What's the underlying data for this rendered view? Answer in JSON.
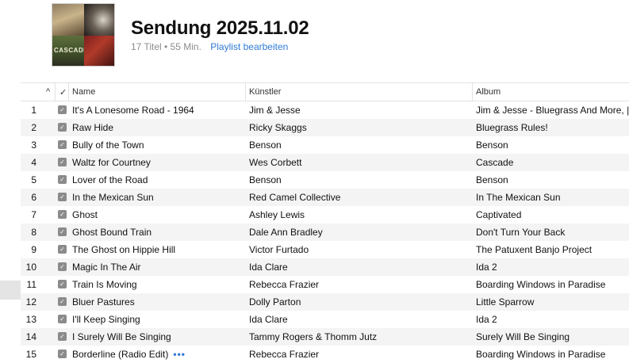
{
  "playlist": {
    "title": "Sendung 2025.11.02",
    "meta": "17 Titel • 55 Min.",
    "edit_label": "Playlist bearbeiten",
    "artwork_text": "CASCADE"
  },
  "columns": {
    "sort_indicator": "^",
    "check": "✓",
    "name": "Name",
    "artist": "Künstler",
    "album": "Album"
  },
  "tracks": [
    {
      "num": "1",
      "name": "It's A Lonesome Road - 1964",
      "artist": "Jim & Jesse",
      "album": "Jim & Jesse - Bluegrass And More, |"
    },
    {
      "num": "2",
      "name": "Raw Hide",
      "artist": "Ricky Skaggs",
      "album": "Bluegrass Rules!"
    },
    {
      "num": "3",
      "name": "Bully of the Town",
      "artist": "Benson",
      "album": "Benson"
    },
    {
      "num": "4",
      "name": "Waltz for Courtney",
      "artist": "Wes Corbett",
      "album": "Cascade"
    },
    {
      "num": "5",
      "name": "Lover of the Road",
      "artist": "Benson",
      "album": "Benson"
    },
    {
      "num": "6",
      "name": " In the Mexican Sun",
      "artist": "Red Camel Collective",
      "album": "In The Mexican Sun"
    },
    {
      "num": "7",
      "name": "Ghost",
      "artist": "Ashley Lewis",
      "album": "Captivated"
    },
    {
      "num": "8",
      "name": "Ghost Bound Train",
      "artist": "Dale Ann Bradley",
      "album": "Don't Turn Your Back"
    },
    {
      "num": "9",
      "name": "The Ghost on Hippie Hill",
      "artist": "Victor Furtado",
      "album": "The Patuxent Banjo Project"
    },
    {
      "num": "10",
      "name": "Magic In The Air",
      "artist": "Ida Clare",
      "album": "Ida 2"
    },
    {
      "num": "11",
      "name": "Train Is Moving",
      "artist": "Rebecca Frazier",
      "album": "Boarding Windows in Paradise"
    },
    {
      "num": "12",
      "name": "Bluer Pastures",
      "artist": "Dolly Parton",
      "album": "Little Sparrow"
    },
    {
      "num": "13",
      "name": "I'll Keep Singing",
      "artist": "Ida Clare",
      "album": "Ida 2"
    },
    {
      "num": "14",
      "name": "I Surely Will Be Singing",
      "artist": "Tammy Rogers & Thomm Jutz",
      "album": "Surely Will Be Singing"
    },
    {
      "num": "15",
      "name": "Borderline (Radio Edit)",
      "artist": "Rebecca Frazier",
      "album": "Boarding Windows in Paradise",
      "more": "•••"
    }
  ]
}
